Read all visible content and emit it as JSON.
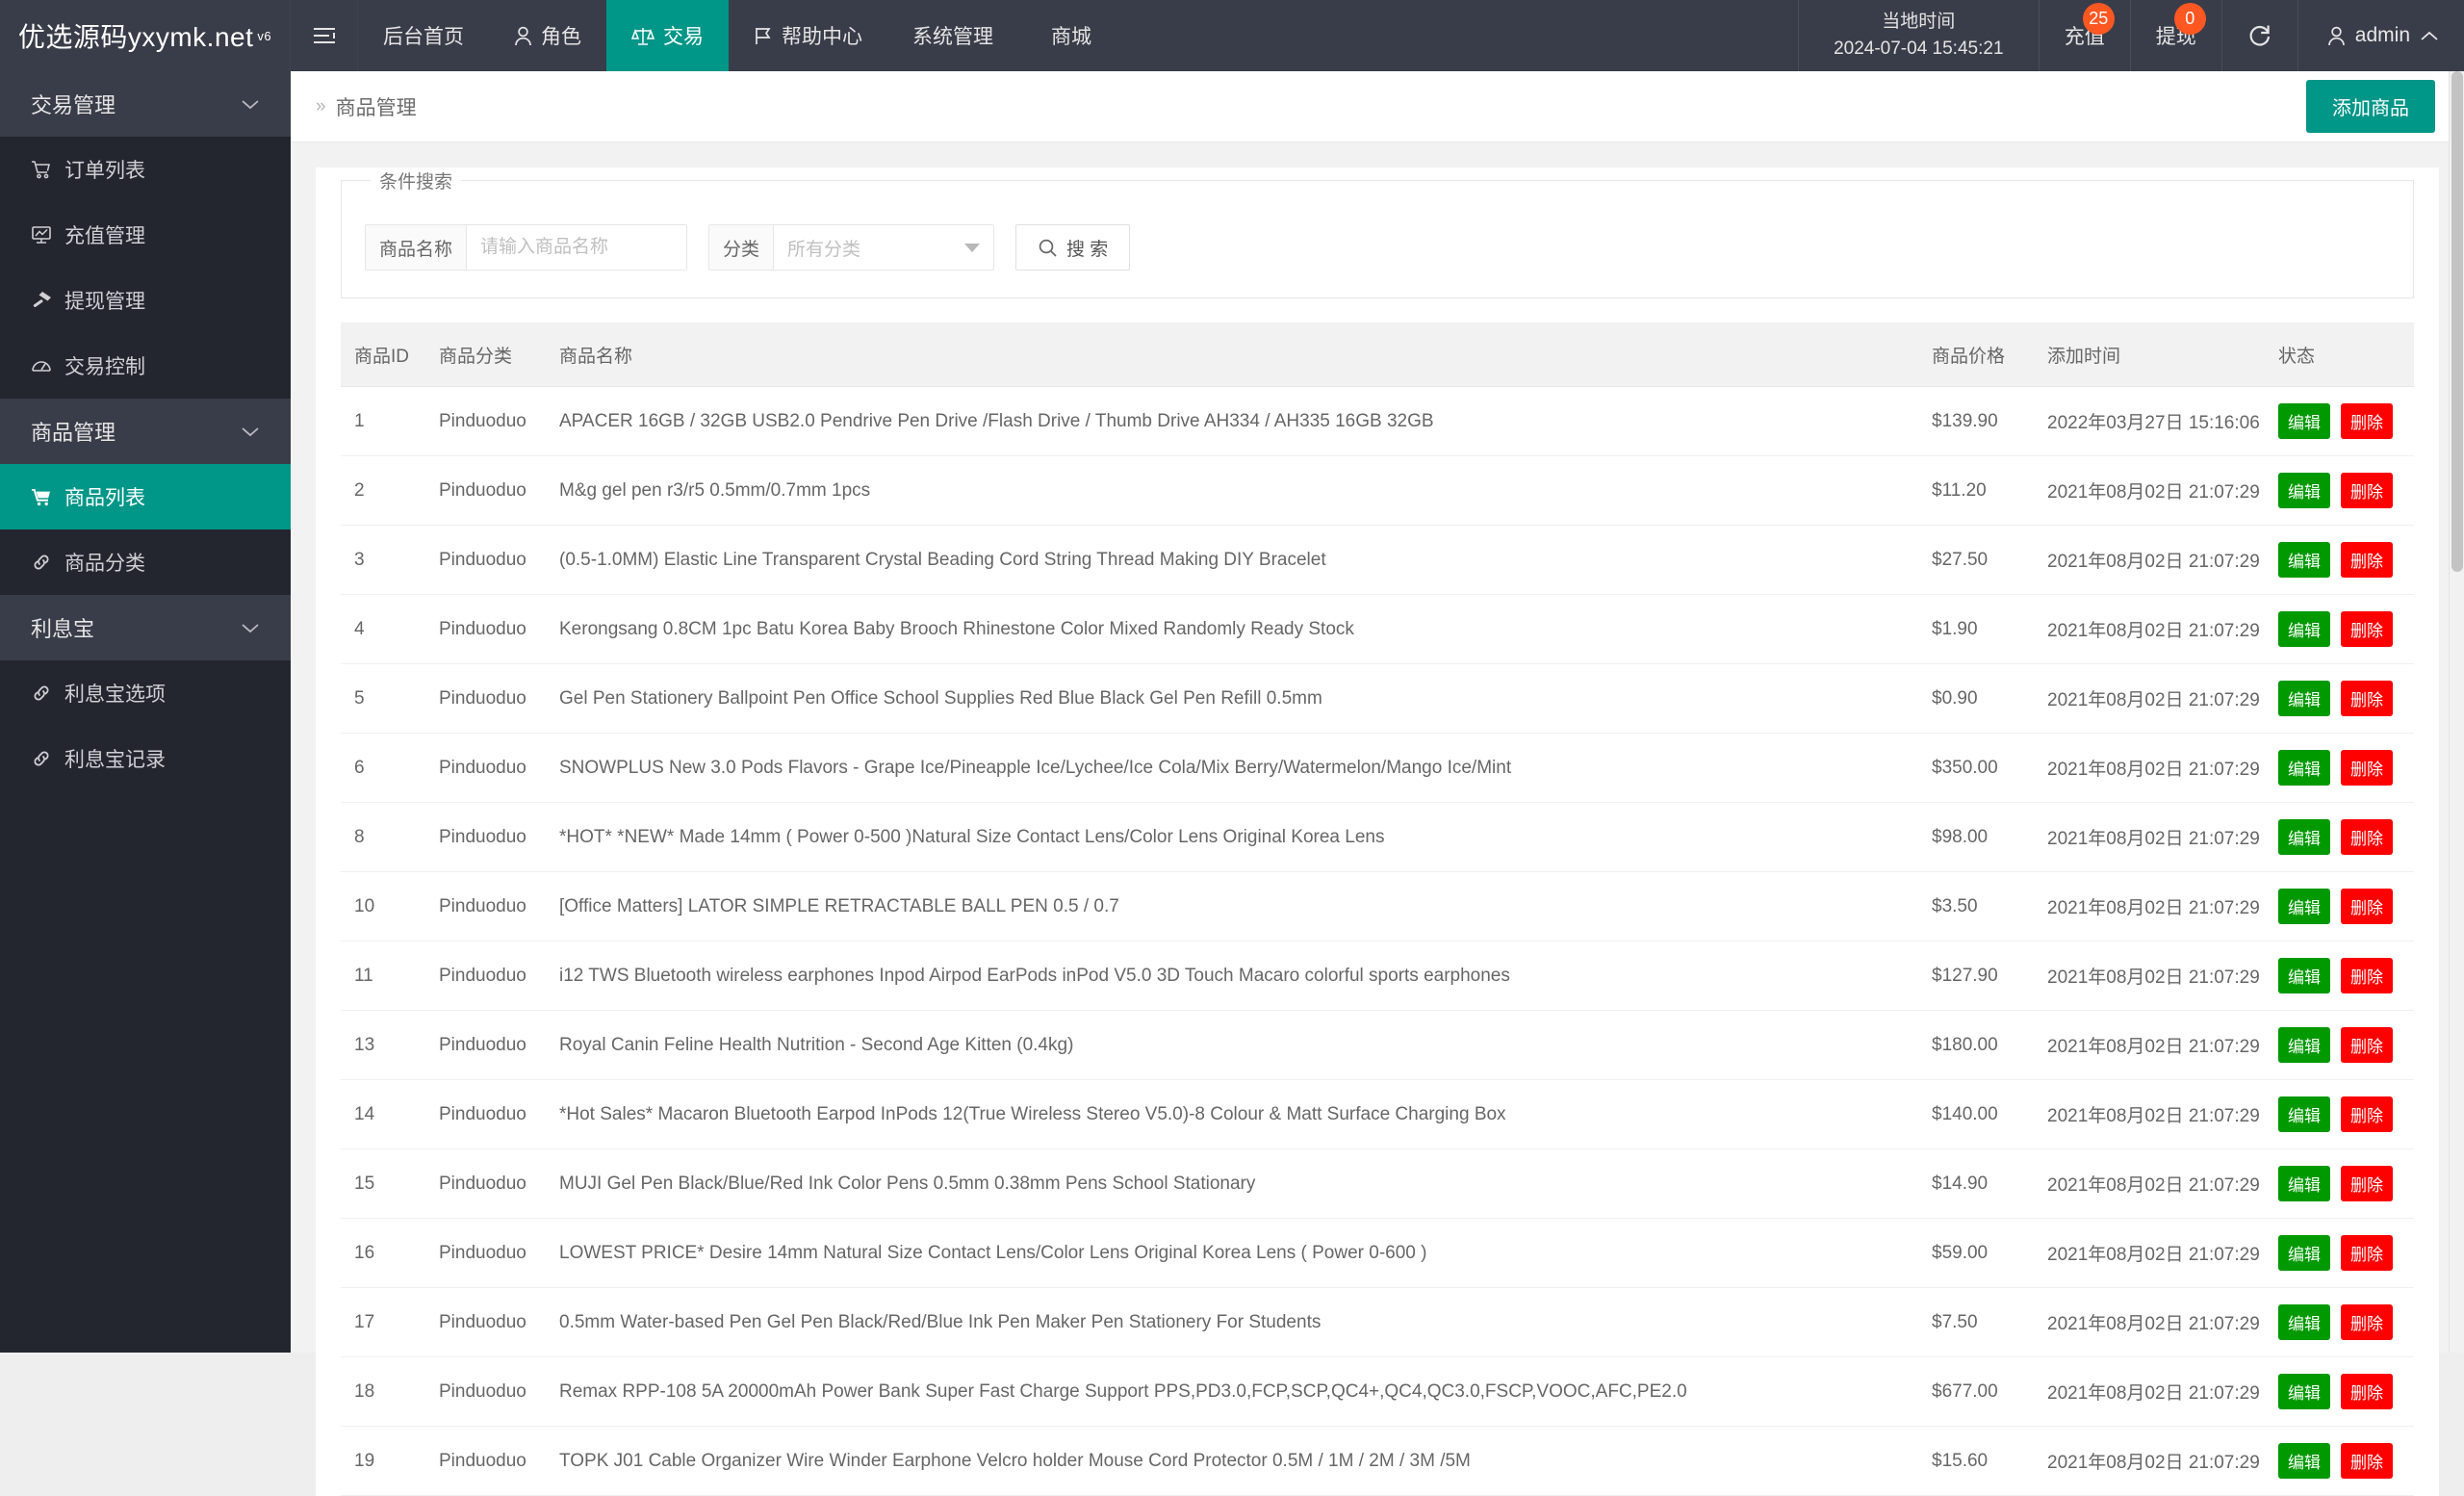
{
  "header": {
    "logo": "优选源码yxymk.net",
    "logo_sup": "v6",
    "nav": [
      {
        "label": "后台首页",
        "icon": "",
        "active": false
      },
      {
        "label": "角色",
        "icon": "user-icon",
        "active": false
      },
      {
        "label": "交易",
        "icon": "scale-icon",
        "active": true
      },
      {
        "label": "帮助中心",
        "icon": "flag-icon",
        "active": false
      },
      {
        "label": "系统管理",
        "icon": "",
        "active": false
      },
      {
        "label": "商城",
        "icon": "",
        "active": false
      }
    ],
    "clock_label": "当地时间",
    "clock_value": "2024-07-04 15:45:21",
    "recharge_label": "充值",
    "recharge_badge": "25",
    "withdraw_label": "提现",
    "withdraw_badge": "0",
    "refresh_icon": "refresh-icon",
    "user_name": "admin"
  },
  "sidebar": {
    "groups": [
      {
        "title": "交易管理",
        "items": [
          {
            "label": "订单列表",
            "icon": "cart-icon",
            "active": false
          },
          {
            "label": "充值管理",
            "icon": "monitor-icon",
            "active": false
          },
          {
            "label": "提现管理",
            "icon": "hammer-icon",
            "active": false
          },
          {
            "label": "交易控制",
            "icon": "gauge-icon",
            "active": false
          }
        ]
      },
      {
        "title": "商品管理",
        "items": [
          {
            "label": "商品列表",
            "icon": "cart-solid-icon",
            "active": true
          },
          {
            "label": "商品分类",
            "icon": "link-icon",
            "active": false
          }
        ]
      },
      {
        "title": "利息宝",
        "items": [
          {
            "label": "利息宝选项",
            "icon": "link-icon",
            "active": false
          },
          {
            "label": "利息宝记录",
            "icon": "link-icon",
            "active": false
          }
        ]
      }
    ]
  },
  "breadcrumb": {
    "prefix": "»",
    "title": "商品管理",
    "add_button": "添加商品"
  },
  "search": {
    "legend": "条件搜索",
    "name_label": "商品名称",
    "name_value": "",
    "name_placeholder": "请输入商品名称",
    "category_label": "分类",
    "category_value": "所有分类",
    "search_button": "搜 索",
    "search_icon": "search-icon"
  },
  "table": {
    "columns": [
      "商品ID",
      "商品分类",
      "商品名称",
      "商品价格",
      "添加时间",
      "状态"
    ],
    "edit_label": "编辑",
    "delete_label": "删除",
    "rows": [
      {
        "id": "1",
        "cat": "Pinduoduo",
        "name": "APACER 16GB / 32GB USB2.0 Pendrive Pen Drive /Flash Drive / Thumb Drive AH334 / AH335 16GB 32GB",
        "price": "$139.90",
        "time": "2022年03月27日 15:16:06"
      },
      {
        "id": "2",
        "cat": "Pinduoduo",
        "name": "M&g gel pen r3/r5 0.5mm/0.7mm 1pcs",
        "price": "$11.20",
        "time": "2021年08月02日 21:07:29"
      },
      {
        "id": "3",
        "cat": "Pinduoduo",
        "name": "(0.5-1.0MM) Elastic Line Transparent Crystal Beading Cord String Thread Making DIY Bracelet",
        "price": "$27.50",
        "time": "2021年08月02日 21:07:29"
      },
      {
        "id": "4",
        "cat": "Pinduoduo",
        "name": "Kerongsang 0.8CM 1pc Batu Korea Baby Brooch Rhinestone Color Mixed Randomly Ready Stock",
        "price": "$1.90",
        "time": "2021年08月02日 21:07:29"
      },
      {
        "id": "5",
        "cat": "Pinduoduo",
        "name": "Gel Pen Stationery Ballpoint Pen Office School Supplies Red Blue Black Gel Pen Refill 0.5mm",
        "price": "$0.90",
        "time": "2021年08月02日 21:07:29"
      },
      {
        "id": "6",
        "cat": "Pinduoduo",
        "name": "SNOWPLUS New 3.0 Pods Flavors - Grape Ice/Pineapple Ice/Lychee/Ice Cola/Mix Berry/Watermelon/Mango Ice/Mint",
        "price": "$350.00",
        "time": "2021年08月02日 21:07:29"
      },
      {
        "id": "8",
        "cat": "Pinduoduo",
        "name": "*HOT* *NEW* Made 14mm ( Power 0-500 )Natural Size Contact Lens/Color Lens Original Korea Lens",
        "price": "$98.00",
        "time": "2021年08月02日 21:07:29"
      },
      {
        "id": "10",
        "cat": "Pinduoduo",
        "name": "[Office Matters] LATOR SIMPLE RETRACTABLE BALL PEN 0.5 / 0.7",
        "price": "$3.50",
        "time": "2021年08月02日 21:07:29"
      },
      {
        "id": "11",
        "cat": "Pinduoduo",
        "name": "i12 TWS Bluetooth wireless earphones Inpod Airpod EarPods inPod V5.0 3D Touch Macaro colorful sports earphones",
        "price": "$127.90",
        "time": "2021年08月02日 21:07:29"
      },
      {
        "id": "13",
        "cat": "Pinduoduo",
        "name": "Royal Canin Feline Health Nutrition - Second Age Kitten (0.4kg)",
        "price": "$180.00",
        "time": "2021年08月02日 21:07:29"
      },
      {
        "id": "14",
        "cat": "Pinduoduo",
        "name": "*Hot Sales* Macaron Bluetooth Earpod InPods 12(True Wireless Stereo V5.0)-8 Colour & Matt Surface Charging Box",
        "price": "$140.00",
        "time": "2021年08月02日 21:07:29"
      },
      {
        "id": "15",
        "cat": "Pinduoduo",
        "name": "MUJI Gel Pen Black/Blue/Red Ink Color Pens 0.5mm 0.38mm Pens School Stationary",
        "price": "$14.90",
        "time": "2021年08月02日 21:07:29"
      },
      {
        "id": "16",
        "cat": "Pinduoduo",
        "name": "LOWEST PRICE* Desire 14mm Natural Size Contact Lens/Color Lens Original Korea Lens ( Power 0-600 )",
        "price": "$59.00",
        "time": "2021年08月02日 21:07:29"
      },
      {
        "id": "17",
        "cat": "Pinduoduo",
        "name": "0.5mm Water-based Pen Gel Pen Black/Red/Blue Ink Pen Maker Pen Stationery For Students",
        "price": "$7.50",
        "time": "2021年08月02日 21:07:29"
      },
      {
        "id": "18",
        "cat": "Pinduoduo",
        "name": "Remax RPP-108 5A 20000mAh Power Bank Super Fast Charge Support PPS,PD3.0,FCP,SCP,QC4+,QC4,QC3.0,FSCP,VOOC,AFC,PE2.0",
        "price": "$677.00",
        "time": "2021年08月02日 21:07:29"
      },
      {
        "id": "19",
        "cat": "Pinduoduo",
        "name": "TOPK J01 Cable Organizer Wire Winder Earphone Velcro holder Mouse Cord Protector 0.5M / 1M / 2M / 3M /5M",
        "price": "$15.60",
        "time": "2021年08月02日 21:07:29"
      }
    ]
  },
  "colors": {
    "brand": "#009688",
    "header_bg": "#393D49",
    "sidebar_bg": "#24262F",
    "badge": "#FF5722",
    "edit": "#009900",
    "delete": "#FF0000"
  }
}
